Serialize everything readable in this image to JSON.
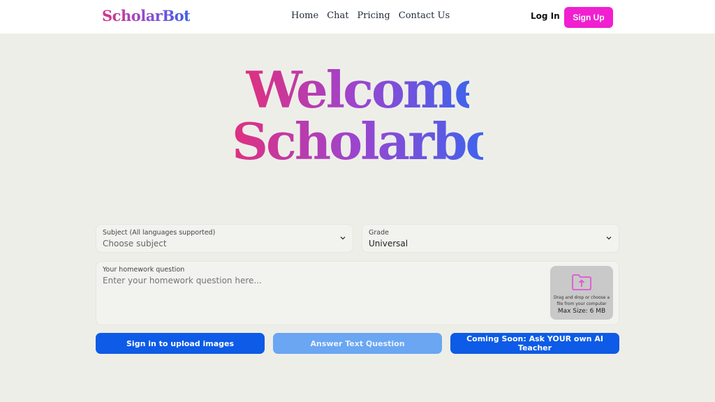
{
  "header": {
    "logo": "ScholarBot",
    "nav": [
      "Home",
      "Chat",
      "Pricing",
      "Contact Us"
    ],
    "login_label": "Log In",
    "signup_label": "Sign Up",
    "signup_color": "#f01fd0"
  },
  "hero": {
    "line1": "Welcome",
    "line2": "Scholarbot"
  },
  "form": {
    "subject": {
      "label": "Subject (All languages supported)",
      "value": "Choose subject"
    },
    "grade": {
      "label": "Grade",
      "value": "Universal"
    },
    "question": {
      "label": "Your homework question",
      "placeholder": "Enter your homework question here..."
    },
    "dropzone": {
      "text": "Drag and drop or choose a file from your computer",
      "max_size": "Max Size: 6 MB",
      "icon": "folder-upload-icon"
    }
  },
  "buttons": {
    "upload": "Sign in to upload images",
    "answer": "Answer Text Question",
    "teacher": "Coming Soon: Ask YOUR own AI Teacher"
  },
  "colors": {
    "primary": "#0d5be6",
    "primary_disabled": "#6aa6f2",
    "accent_pink": "#d63384",
    "accent_blue": "#3b5fe6"
  }
}
